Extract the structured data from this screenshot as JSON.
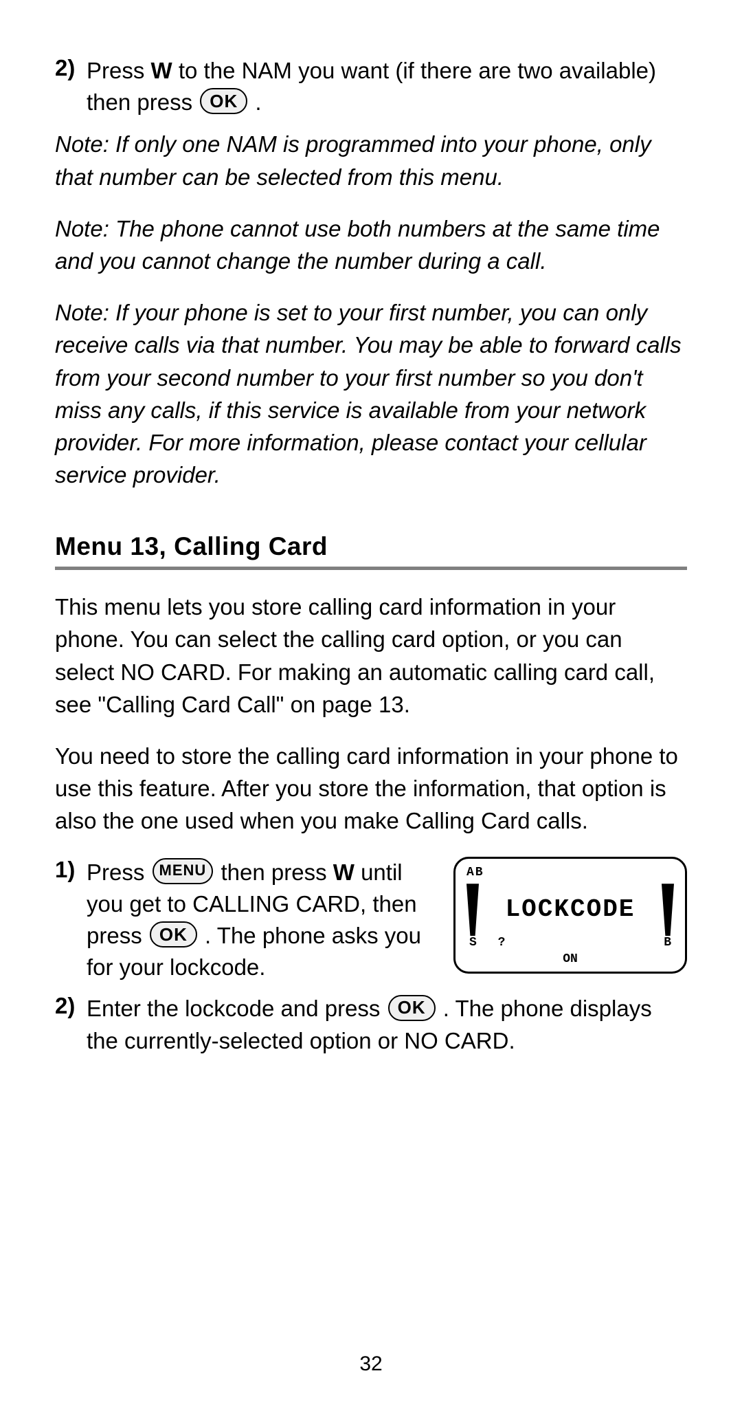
{
  "steps_top": {
    "num2": "2)",
    "text_a": "Press ",
    "text_w": "W",
    "text_b": " to the NAM you want (if there are two available) then press ",
    "key_ok": "OK",
    "text_c": " ."
  },
  "notes": {
    "n1": "Note: If only one NAM is programmed into your phone, only that number can be selected from this menu.",
    "n2": "Note: The phone cannot use both numbers at the same time and you cannot change the number during a call.",
    "n3": "Note: If your phone is set to your first number, you can only receive calls via that number. You may be able to forward calls from your second number to your first number so you don't miss any calls, if this service is available from your network provider. For more information, please contact your cellular service provider."
  },
  "heading": "Menu 13, Calling Card",
  "para1": {
    "a": "This menu lets you store calling card information in your phone. You can select the calling card option, or you can select ",
    "nocard": "NO CARD",
    "b": ". For making an automatic calling card call, see \"Calling Card Call\" on page 13."
  },
  "para2": "You need to store the calling card information in your phone to use this feature. After you store the information, that option is also the one used when you make Calling Card calls.",
  "steps_menu13": {
    "s1_num": "1)",
    "s1_a": "Press ",
    "s1_menu": "MENU",
    "s1_b": " then press ",
    "s1_w": "W",
    "s1_c": " until you get to ",
    "s1_calling": "CALLING CARD",
    "s1_then": ", then press ",
    "s1_ok": "OK",
    "s1_d": " . The phone asks you for your lockcode.",
    "s2_num": "2)",
    "s2_a": "Enter the lockcode and press ",
    "s2_ok": "OK",
    "s2_b": " . The phone displays the currently-selected option or ",
    "s2_nocard": "NO CARD",
    "s2_c": "."
  },
  "lcd": {
    "top": "AB",
    "main": "LOCKCODE",
    "row2_left": "S",
    "row2_mid": "?",
    "row2_right": "B",
    "row3": "ON"
  },
  "page_number": "32"
}
